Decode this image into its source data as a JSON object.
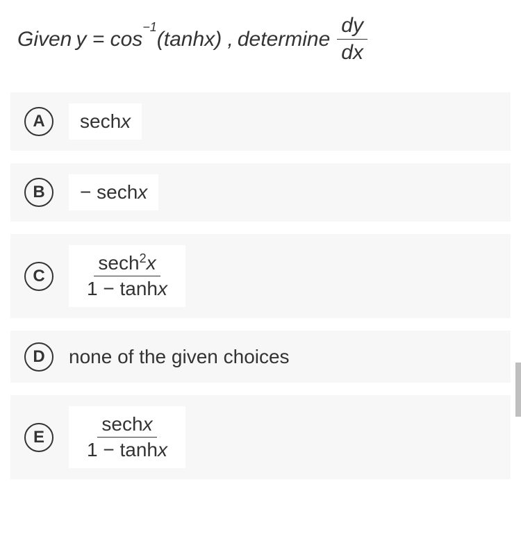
{
  "question": {
    "prefix": "Given ",
    "expr_left": "y = cos",
    "sup": "−1",
    "expr_right": "(tanh",
    "var": "x",
    "close": ") ,",
    "verb": " determine ",
    "frac_num": "dy",
    "frac_den": "dx"
  },
  "options": [
    {
      "letter": "A",
      "text": "sechx",
      "type": "plain"
    },
    {
      "letter": "B",
      "text": "− sechx",
      "type": "plain"
    },
    {
      "letter": "C",
      "num": "sech²x",
      "den": "1 − tanhx",
      "type": "frac"
    },
    {
      "letter": "D",
      "text": "none of the given choices",
      "type": "text"
    },
    {
      "letter": "E",
      "num": "sechx",
      "den": "1 − tanhx",
      "type": "frac"
    }
  ]
}
